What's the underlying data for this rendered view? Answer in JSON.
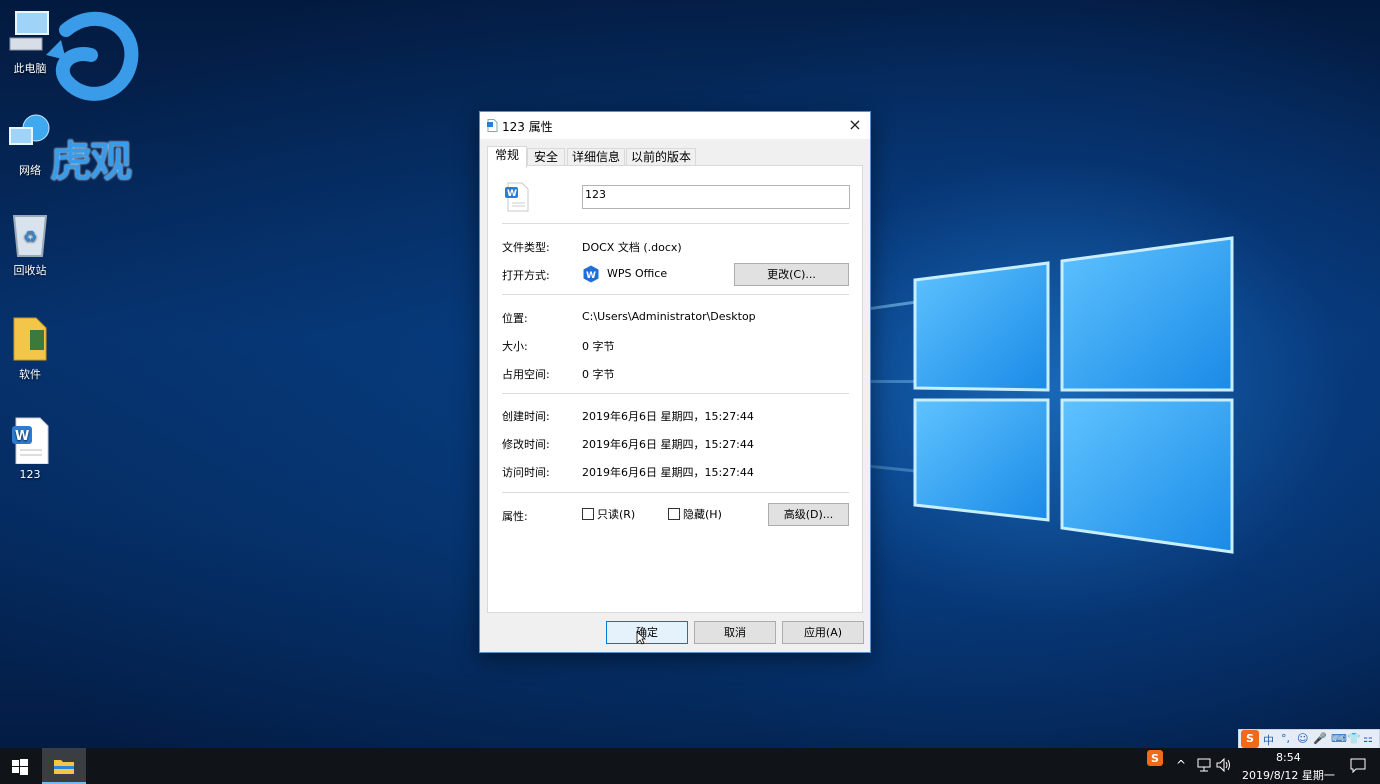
{
  "desktop": {
    "watermark_text": "虎观",
    "icons": [
      {
        "label": "此电脑"
      },
      {
        "label": "网络"
      },
      {
        "label": "回收站"
      },
      {
        "label": "软件"
      },
      {
        "label": "123"
      }
    ]
  },
  "dialog": {
    "title": "123 属性",
    "close_glyph": "×",
    "tabs": [
      {
        "label": "常规",
        "active": true
      },
      {
        "label": "安全"
      },
      {
        "label": "详细信息"
      },
      {
        "label": "以前的版本"
      }
    ],
    "file_name": "123",
    "file_type_label": "文件类型:",
    "file_type_value": "DOCX 文档 (.docx)",
    "opens_with_label": "打开方式:",
    "opens_with_value": "WPS Office",
    "change_button": "更改(C)...",
    "location_label": "位置:",
    "location_value": "C:\\Users\\Administrator\\Desktop",
    "size_label": "大小:",
    "size_value": "0 字节",
    "size_on_disk_label": "占用空间:",
    "size_on_disk_value": "0 字节",
    "created_label": "创建时间:",
    "created_value": "2019年6月6日 星期四，15:27:44",
    "modified_label": "修改时间:",
    "modified_value": "2019年6月6日 星期四，15:27:44",
    "accessed_label": "访问时间:",
    "accessed_value": "2019年6月6日 星期四，15:27:44",
    "attributes_label": "属性:",
    "readonly_label": "只读(R)",
    "readonly_checked": false,
    "hidden_label": "隐藏(H)",
    "hidden_checked": false,
    "advanced_button": "高级(D)...",
    "ok_button": "确定",
    "cancel_button": "取消",
    "apply_button": "应用(A)"
  },
  "taskbar": {
    "tray_chevron": "^",
    "clock_time": "8:54",
    "clock_date": "2019/8/12 星期一",
    "ime_items": [
      "S",
      "中",
      "°,",
      "☺",
      "🎤",
      "⌨",
      "👕",
      "⚏"
    ]
  },
  "colors": {
    "accent": "#0078d7",
    "wps_blue": "#1e6fd9",
    "taskbar": "#101318"
  }
}
